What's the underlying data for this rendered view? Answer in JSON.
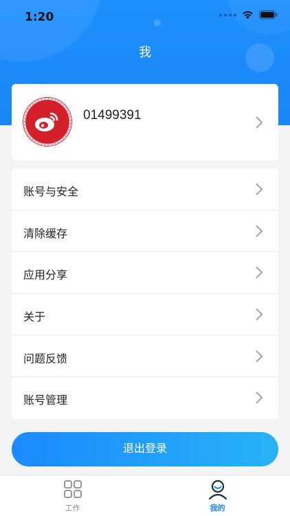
{
  "status_bar": {
    "time": "1:20"
  },
  "header": {
    "title": "我"
  },
  "profile": {
    "account_id": "01499391",
    "avatar_icon": "weibo-logo-icon"
  },
  "menu": {
    "items": [
      {
        "label": "账号与安全"
      },
      {
        "label": "清除缓存"
      },
      {
        "label": "应用分享"
      },
      {
        "label": "关于"
      },
      {
        "label": "问题反馈"
      },
      {
        "label": "账号管理"
      }
    ]
  },
  "logout": {
    "label": "退出登录"
  },
  "tabs": [
    {
      "label": "工作",
      "icon": "grid-icon"
    },
    {
      "label": "我的",
      "icon": "user-icon"
    }
  ],
  "colors": {
    "primary": "#1a86f7",
    "avatar": "#d4202a",
    "background": "#f3f4f6"
  }
}
